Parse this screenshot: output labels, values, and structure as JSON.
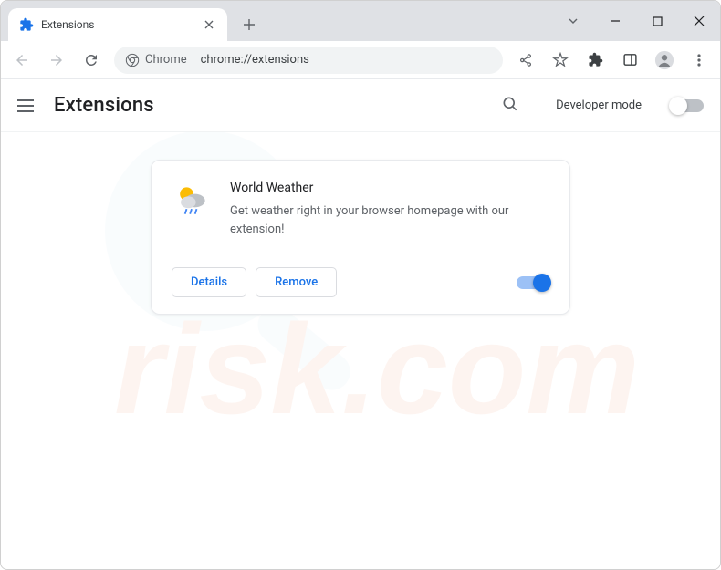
{
  "window": {
    "tab_title": "Extensions"
  },
  "omnibox": {
    "chip": "Chrome",
    "url": "chrome://extensions"
  },
  "header": {
    "title": "Extensions",
    "dev_mode_label": "Developer mode",
    "dev_mode_on": false
  },
  "extension": {
    "name": "World Weather",
    "description": "Get weather right in your browser homepage with our extension!",
    "details_label": "Details",
    "remove_label": "Remove",
    "enabled": true
  }
}
